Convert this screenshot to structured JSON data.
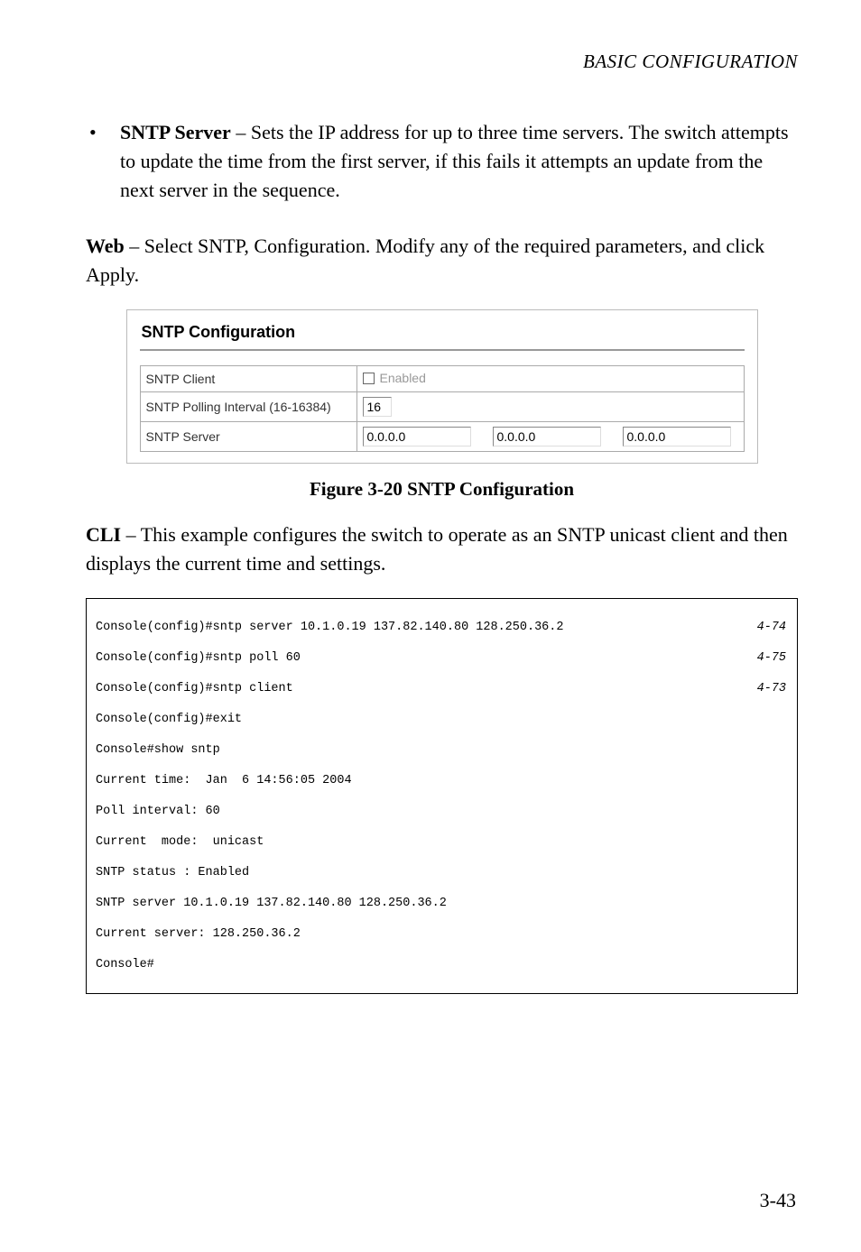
{
  "header": "BASIC CONFIGURATION",
  "bullet": {
    "marker": "•",
    "bold": "SNTP Server",
    "text": " – Sets the IP address for up to three time servers. The switch attempts to update the time from the first server, if this fails it attempts an update from the next server in the sequence."
  },
  "web_label": "Web",
  "web_text": " – Select SNTP, Configuration. Modify any of the required parameters, and click Apply.",
  "panel": {
    "title": "SNTP Configuration",
    "client_label": "SNTP Client",
    "enabled_label": "Enabled",
    "polling_label": "SNTP Polling Interval (16-16384)",
    "polling_value": "16",
    "server_label": "SNTP Server",
    "server_values": [
      "0.0.0.0",
      "0.0.0.0",
      "0.0.0.0"
    ]
  },
  "figure_caption": "Figure 3-20  SNTP Configuration",
  "cli_label": "CLI",
  "cli_text": " – This example configures the switch to operate as an SNTP unicast client and then displays the current time and settings.",
  "cli": {
    "lines": [
      {
        "cmd": "Console(config)#sntp server 10.1.0.19 137.82.140.80 128.250.36.2",
        "ref": "4-74"
      },
      {
        "cmd": "Console(config)#sntp poll 60",
        "ref": "4-75"
      },
      {
        "cmd": "Console(config)#sntp client",
        "ref": "4-73"
      },
      {
        "cmd": "Console(config)#exit",
        "ref": ""
      },
      {
        "cmd": "Console#show sntp",
        "ref": ""
      },
      {
        "cmd": "Current time:  Jan  6 14:56:05 2004",
        "ref": ""
      },
      {
        "cmd": "Poll interval: 60",
        "ref": ""
      },
      {
        "cmd": "Current  mode:  unicast",
        "ref": ""
      },
      {
        "cmd": "SNTP status : Enabled",
        "ref": ""
      },
      {
        "cmd": "SNTP server 10.1.0.19 137.82.140.80 128.250.36.2",
        "ref": ""
      },
      {
        "cmd": "Current server: 128.250.36.2",
        "ref": ""
      },
      {
        "cmd": "Console#",
        "ref": ""
      }
    ]
  },
  "page_number": "3-43"
}
